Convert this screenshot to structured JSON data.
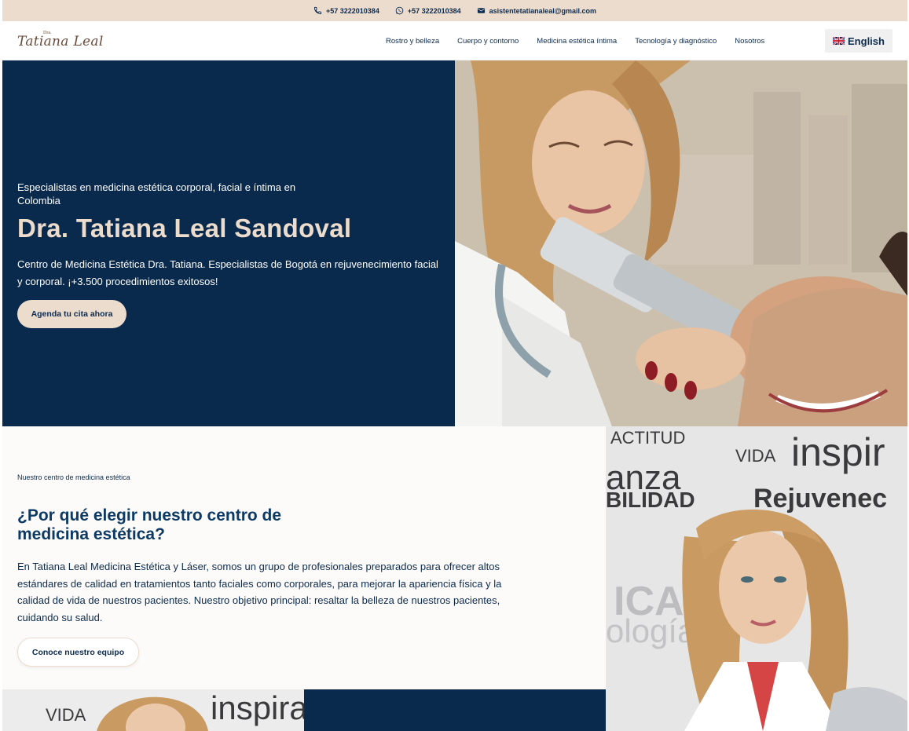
{
  "topbar": {
    "phone": "+57 3222010384",
    "whatsapp": "+57 3222010384",
    "email": "asistentetatianaleal@gmail.com"
  },
  "header": {
    "logo_small": "Dra.",
    "logo_script": "Tatiana Leal",
    "nav": [
      "Rostro y belleza",
      "Cuerpo y contorno",
      "Medicina estética íntima",
      "Tecnología y diagnóstico",
      "Nosotros"
    ],
    "language": "English"
  },
  "hero": {
    "eyebrow": "Especialistas en medicina estética corporal, facial e íntima en Colombia",
    "title": "Dra. Tatiana Leal Sandoval",
    "description": "Centro de Medicina Estética Dra. Tatiana. Especialistas de Bogotá en rejuvenecimiento facial y corporal. ¡+3.500 procedimientos exitosos!",
    "cta": "Agenda tu cita ahora"
  },
  "why": {
    "eyebrow": "Nuestro centro de medicina estética",
    "title": "¿Por qué elegir nuestro centro de medicina estética?",
    "description": "En Tatiana Leal Medicina Estética y Láser, somos un grupo de profesionales preparados para ofrecer altos estándares de calidad en tratamientos tanto faciales como corporales, para mejorar la apariencia física y la calidad de vida de nuestros pacientes. Nuestro objetivo principal: resaltar la belleza de nuestros pacientes, cuidando su salud.",
    "cta": "Conoce nuestro equipo"
  },
  "wall_words": [
    "ACTITUD",
    "VIDA",
    "inspir",
    "anza",
    "BILIDAD",
    "Rejuvenec",
    "ICA",
    "ología"
  ],
  "wall_words_bottom": [
    "VIDA",
    "inspirac"
  ],
  "colors": {
    "navy": "#0a2a4d",
    "sand": "#ecdccd",
    "text": "#0d2b4e"
  },
  "icons": [
    "phone-icon",
    "whatsapp-icon",
    "mail-icon",
    "uk-flag-icon"
  ]
}
